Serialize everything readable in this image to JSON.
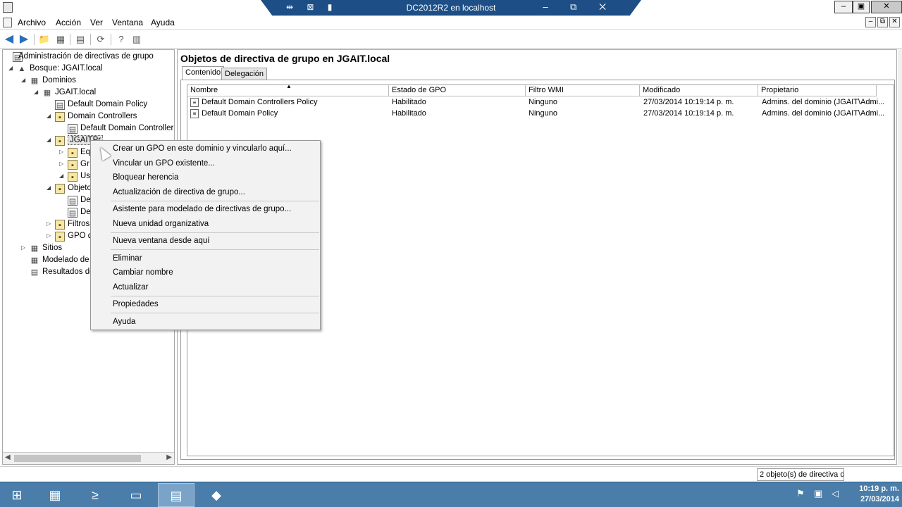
{
  "window": {
    "rdp_title": "DC2012R2 en localhost",
    "rdp_left_icons": "⇹ ⊠ ▮",
    "rdp_right_icons": "– ⧉ ✕",
    "min_label": "–",
    "max_label": "▣",
    "close_label": "✕"
  },
  "menu": {
    "items": [
      "Archivo",
      "Acción",
      "Ver",
      "Ventana",
      "Ayuda"
    ],
    "child_controls": [
      "–",
      "⧉",
      "✕"
    ]
  },
  "toolbar": {
    "back_icon": "back-arrow-icon",
    "forward_icon": "forward-arrow-icon"
  },
  "tree": {
    "root": "Administración de directivas de grupo",
    "forest": "Bosque: JGAIT.local",
    "domains": "Dominios",
    "domain": "JGAIT.local",
    "ddp": "Default Domain Policy",
    "dc_ou": "Domain Controllers",
    "ddcp": "Default Domain Controller",
    "selected_ou": "JGAITPr",
    "ou_children": [
      "Eq",
      "Gr",
      "Us"
    ],
    "gpo_objects": "Objeto",
    "gpo_children": [
      "De",
      "De"
    ],
    "wmi_filters": "Filtros",
    "starter_gpo": "GPO d",
    "sites": "Sitios",
    "modeling": "Modelado de",
    "results": "Resultados de"
  },
  "right": {
    "title": "Objetos de directiva de grupo en JGAIT.local",
    "tabs": [
      "Contenido",
      "Delegación"
    ],
    "columns": [
      "Nombre",
      "Estado de GPO",
      "Filtro WMI",
      "Modificado",
      "Propietario"
    ],
    "rows": [
      [
        "Default Domain Controllers Policy",
        "Habilitado",
        "Ninguno",
        "27/03/2014 10:19:14 p. m.",
        "Admins. del dominio (JGAIT\\Admi..."
      ],
      [
        "Default Domain Policy",
        "Habilitado",
        "Ninguno",
        "27/03/2014 10:19:14 p. m.",
        "Admins. del dominio (JGAIT\\Admi..."
      ]
    ]
  },
  "context_menu": {
    "items": [
      "Crear un GPO en este dominio y vincularlo aquí...",
      "Vincular un GPO existente...",
      "Bloquear herencia",
      "Actualización de directiva de grupo...",
      "Asistente para modelado de directivas de grupo...",
      "Nueva unidad organizativa",
      "Nueva ventana desde aquí",
      "Eliminar",
      "Cambiar nombre",
      "Actualizar",
      "Propiedades",
      "Ayuda"
    ]
  },
  "status": {
    "text": "2 objeto(s) de directiva d"
  },
  "taskbar": {
    "clock_time": "10:19 p. m.",
    "clock_date": "27/03/2014"
  }
}
